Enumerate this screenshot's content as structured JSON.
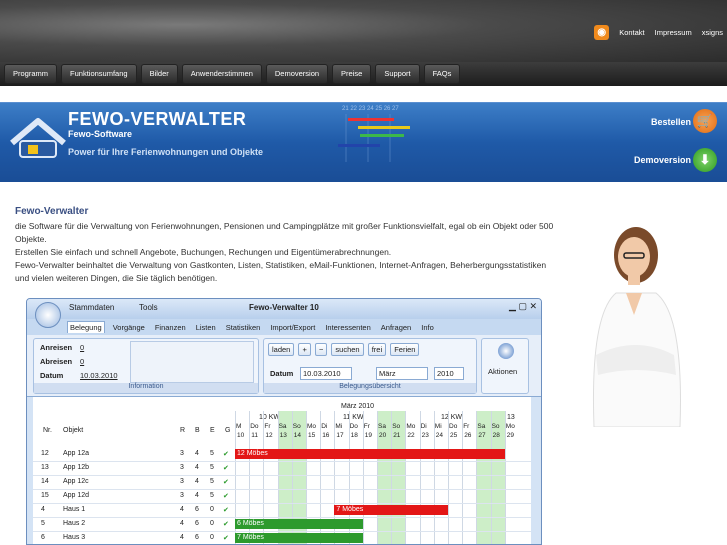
{
  "toplinks": {
    "kontakt": "Kontakt",
    "impressum": "Impressum",
    "xsigns": "xsigns"
  },
  "nav": [
    "Programm",
    "Funktionsumfang",
    "Bilder",
    "Anwenderstimmen",
    "Demoversion",
    "Preise",
    "Support",
    "FAQs"
  ],
  "banner": {
    "title": "FEWO-VERWALTER",
    "subtitle": "Fewo-Software",
    "tagline": "Power für Ihre Ferienwohnungen und Objekte",
    "bestellen": "Bestellen",
    "demoversion": "Demoversion",
    "cal_days": "21 22 23 24 25 26 27"
  },
  "content": {
    "heading": "Fewo-Verwalter",
    "p1": "die Software für die Verwaltung von Ferienwohnungen, Pensionen und Campingplätze mit großer Funktionsvielfalt, egal ob ein Objekt oder 500 Objekte.",
    "p2": "Erstellen Sie einfach und schnell Angebote, Buchungen, Rechungen und Eigentümerabrechnungen.",
    "p3": "Fewo-Verwalter beinhaltet die Verwaltung von Gastkonten, Listen, Statistiken, eMail-Funktionen, Internet-Anfragen, Beherbergungsstatistiken und vielen weiteren Dingen, die Sie täglich benötigen."
  },
  "app": {
    "title": "Fewo-Verwalter 10",
    "qat1": "Stammdaten",
    "qat2": "Tools",
    "tabs": [
      "Belegung",
      "Vorgänge",
      "Finanzen",
      "Listen",
      "Statistiken",
      "Import/Export",
      "Interessenten",
      "Anfragen",
      "Info"
    ],
    "info": {
      "anreisen_l": "Anreisen",
      "anreisen_v": "0",
      "abreisen_l": "Abreisen",
      "abreisen_v": "0",
      "datum_l": "Datum",
      "datum_v": "10.03.2010",
      "label": "Information"
    },
    "beleg": {
      "laden": "laden",
      "suchen": "suchen",
      "frei": "frei",
      "ferien": "Ferien",
      "datum_l": "Datum",
      "datum_v": "10.03.2010",
      "monat": "März",
      "jahr": "2010",
      "label": "Belegungsübersicht"
    },
    "aktionen": "Aktionen",
    "grid": {
      "month": "März 2010",
      "kw10": "10 KW",
      "kw11": "11 KW",
      "kw12": "12 KW",
      "kw13": "13",
      "days": [
        "M",
        "Do",
        "Fr",
        "Sa",
        "So",
        "Mo",
        "Di",
        "Mi",
        "Do",
        "Fr",
        "Sa",
        "So",
        "Mo",
        "Di",
        "Mi",
        "Do",
        "Fr",
        "Sa",
        "So",
        "Mo"
      ],
      "dates": [
        "10",
        "11",
        "12",
        "13",
        "14",
        "15",
        "16",
        "17",
        "18",
        "19",
        "20",
        "21",
        "22",
        "23",
        "24",
        "25",
        "26",
        "27",
        "28",
        "29"
      ],
      "hdr": {
        "nr": "Nr.",
        "objekt": "Objekt",
        "r": "R",
        "b": "B",
        "e": "E",
        "g": "G"
      },
      "rows": [
        {
          "nr": "12",
          "obj": "App 12a",
          "r": "3",
          "b": "4",
          "e": "5",
          "bar": "12 Möbes"
        },
        {
          "nr": "13",
          "obj": "App 12b",
          "r": "3",
          "b": "4",
          "e": "5",
          "bar": ""
        },
        {
          "nr": "14",
          "obj": "App 12c",
          "r": "3",
          "b": "4",
          "e": "5",
          "bar": ""
        },
        {
          "nr": "15",
          "obj": "App 12d",
          "r": "3",
          "b": "4",
          "e": "5",
          "bar": ""
        },
        {
          "nr": "4",
          "obj": "Haus 1",
          "r": "4",
          "b": "6",
          "e": "0",
          "bar": "7 Möbes"
        },
        {
          "nr": "5",
          "obj": "Haus 2",
          "r": "4",
          "b": "6",
          "e": "0",
          "bar": "6 Möbes"
        },
        {
          "nr": "6",
          "obj": "Haus 3",
          "r": "4",
          "b": "6",
          "e": "0",
          "bar": "7 Möbes"
        }
      ]
    }
  }
}
